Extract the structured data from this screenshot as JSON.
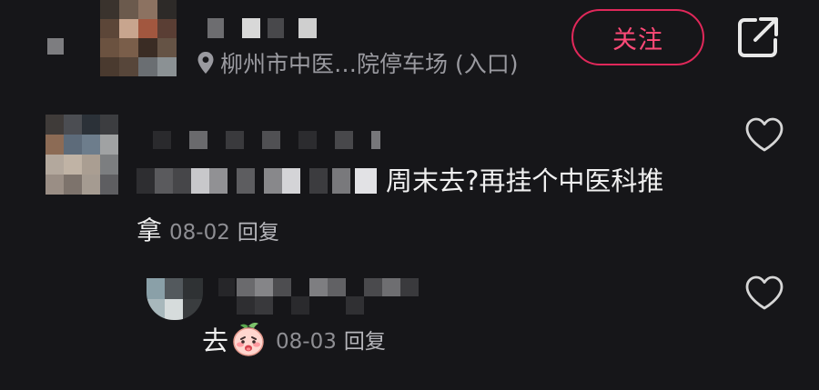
{
  "header": {
    "location": "柳州市中医…院停车场 (入口)",
    "follow_label": "关注",
    "icons": {
      "location": "location-pin-icon",
      "share": "share-external-icon"
    },
    "colors": {
      "follow": "#e0285a",
      "background": "#161619"
    }
  },
  "comments": [
    {
      "text": "周末去?再挂个中医科推",
      "continuation": "拿",
      "date": "08-02",
      "reply_label": "回复",
      "icon": "heart-outline-icon"
    },
    {
      "text": "去",
      "emoji": "peach-face-emoji",
      "date": "08-03",
      "reply_label": "回复",
      "icon": "heart-outline-icon"
    }
  ]
}
